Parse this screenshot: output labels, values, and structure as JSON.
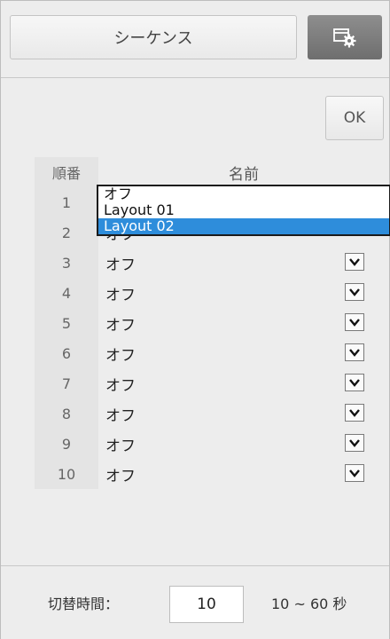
{
  "header": {
    "sequence_label": "シーケンス",
    "settings_icon": "window-gear-icon"
  },
  "ok_label": "OK",
  "table": {
    "order_header": "順番",
    "name_header": "名前",
    "rows": [
      {
        "num": "1",
        "value": "オフ"
      },
      {
        "num": "2",
        "value": "オフ"
      },
      {
        "num": "3",
        "value": "オフ"
      },
      {
        "num": "4",
        "value": "オフ"
      },
      {
        "num": "5",
        "value": "オフ"
      },
      {
        "num": "6",
        "value": "オフ"
      },
      {
        "num": "7",
        "value": "オフ"
      },
      {
        "num": "8",
        "value": "オフ"
      },
      {
        "num": "9",
        "value": "オフ"
      },
      {
        "num": "10",
        "value": "オフ"
      }
    ]
  },
  "dropdown": {
    "options": [
      "オフ",
      "Layout 01",
      "Layout 02"
    ],
    "selected": "Layout 02"
  },
  "footer": {
    "switch_time_label": "切替時間：",
    "switch_time_value": "10",
    "range_text": "10 ~ 60 秒"
  },
  "colors": {
    "selection": "#2e8ddb",
    "settings_button": "#7b7b7b"
  }
}
